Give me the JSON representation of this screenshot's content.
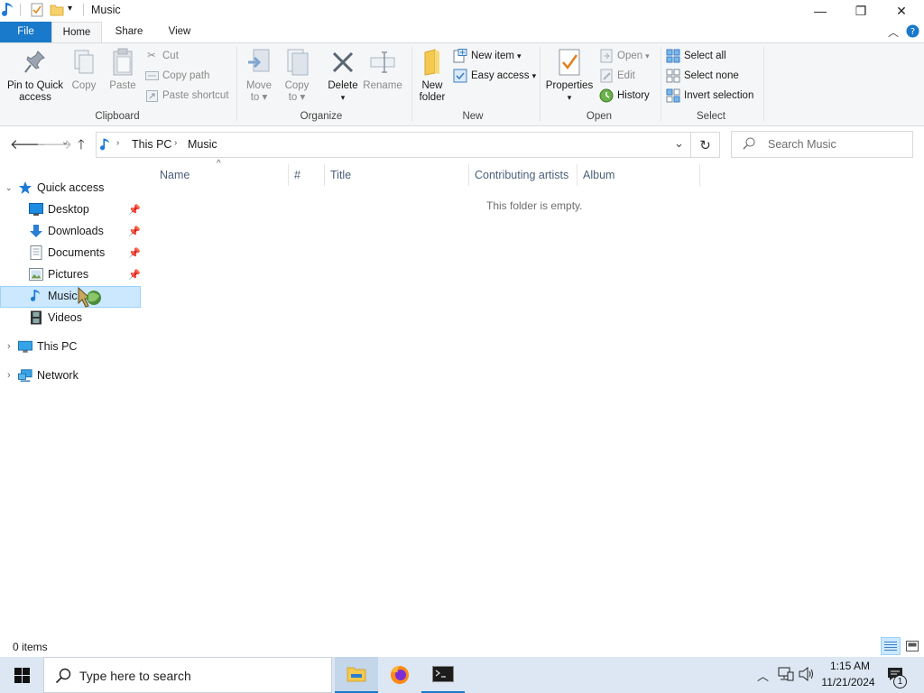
{
  "window": {
    "title": "Music",
    "controls": {
      "minimize": "—",
      "maximize": "❐",
      "close": "✕"
    }
  },
  "ribbon_tabs": [
    {
      "label": "File",
      "active": false
    },
    {
      "label": "Home",
      "active": true
    },
    {
      "label": "Share",
      "active": false
    },
    {
      "label": "View",
      "active": false
    }
  ],
  "ribbon": {
    "clipboard": {
      "label": "Clipboard",
      "pin_label_1": "Pin to Quick",
      "pin_label_2": "access",
      "copy": "Copy",
      "paste": "Paste",
      "cut": "Cut",
      "copy_path": "Copy path",
      "paste_shortcut": "Paste shortcut"
    },
    "organize": {
      "label": "Organize",
      "move_to_1": "Move",
      "move_to_2": "to",
      "copy_to_1": "Copy",
      "copy_to_2": "to",
      "delete": "Delete",
      "rename": "Rename"
    },
    "new": {
      "label": "New",
      "new_folder_1": "New",
      "new_folder_2": "folder",
      "new_item": "New item",
      "easy_access": "Easy access"
    },
    "open": {
      "label": "Open",
      "properties": "Properties",
      "open": "Open",
      "edit": "Edit",
      "history": "History"
    },
    "select": {
      "label": "Select",
      "select_all": "Select all",
      "select_none": "Select none",
      "invert_selection": "Invert selection"
    }
  },
  "address": {
    "crumbs": [
      "This PC",
      "Music"
    ],
    "search_placeholder": "Search Music"
  },
  "navpane": {
    "quick_access": "Quick access",
    "items": [
      {
        "label": "Desktop",
        "pinned": true
      },
      {
        "label": "Downloads",
        "pinned": true
      },
      {
        "label": "Documents",
        "pinned": true
      },
      {
        "label": "Pictures",
        "pinned": true
      },
      {
        "label": "Music",
        "pinned": false,
        "selected": true
      },
      {
        "label": "Videos",
        "pinned": false
      }
    ],
    "this_pc": "This PC",
    "network": "Network"
  },
  "columns": [
    "Name",
    "#",
    "Title",
    "Contributing artists",
    "Album"
  ],
  "empty_message": "This folder is empty.",
  "status": {
    "items": "0 items"
  },
  "taskbar": {
    "search_placeholder": "Type here to search",
    "time": "1:15 AM",
    "date": "11/21/2024",
    "notification_count": "1"
  },
  "colors": {
    "accent": "#1979ca",
    "taskbar": "#dce7f3",
    "selection": "#cce8ff",
    "selection_border": "#99d1ff"
  }
}
